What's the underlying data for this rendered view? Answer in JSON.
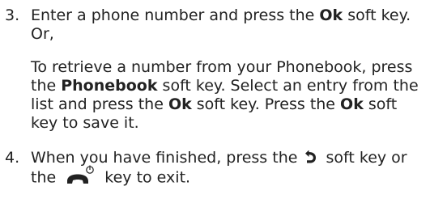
{
  "steps": [
    {
      "number": "3.",
      "line1_before": "Enter a phone number and press the ",
      "line1_bold": "Ok",
      "line1_after": " soft key. Or,",
      "p2_a": "To retrieve a number from your Phonebook, press the ",
      "p2_b_bold": "Phonebook",
      "p2_c": " soft key. Select an entry from the list and press the ",
      "p2_d_bold": "Ok",
      "p2_e": " soft key. Press the ",
      "p2_f_bold": "Ok",
      "p2_g": " soft key to save it."
    },
    {
      "number": "4.",
      "text_a": "When you have finished, press the ",
      "text_b": " soft key or the ",
      "text_c": " key to exit."
    }
  ],
  "icons": {
    "back": "back-arrow-icon",
    "end_power": "end-power-key-icon"
  }
}
